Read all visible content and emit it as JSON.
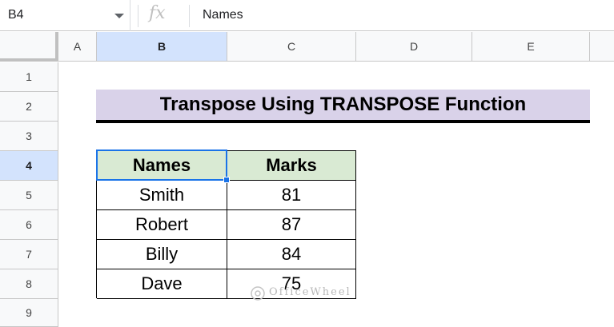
{
  "formula_bar": {
    "cell_ref": "B4",
    "fx": "fx",
    "formula": "Names"
  },
  "columns": [
    "A",
    "B",
    "C",
    "D",
    "E"
  ],
  "rows": [
    "1",
    "2",
    "3",
    "4",
    "5",
    "6",
    "7",
    "8",
    "9"
  ],
  "selected": {
    "column": "B",
    "row": "4"
  },
  "sheet": {
    "title": "Transpose Using TRANSPOSE Function",
    "table": {
      "headers": [
        "Names",
        "Marks"
      ],
      "rows": [
        [
          "Smith",
          "81"
        ],
        [
          "Robert",
          "87"
        ],
        [
          "Billy",
          "84"
        ],
        [
          "Dave",
          "75"
        ]
      ]
    }
  },
  "watermark": "OfficeWheel",
  "colors": {
    "title_bg": "#d9d2e9",
    "header_bg": "#d9ead3",
    "selection": "#1a73e8",
    "header_selected": "#d3e3fd"
  }
}
